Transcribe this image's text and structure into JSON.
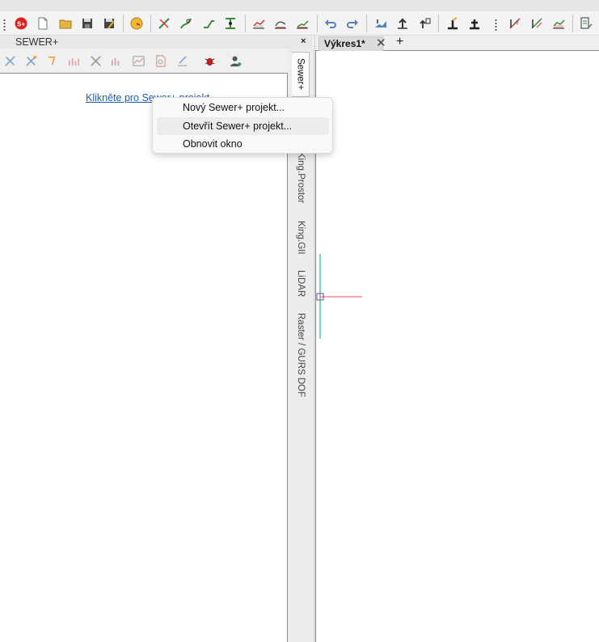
{
  "toolbar": {
    "icons": [
      "sewer-plus-icon",
      "new-document-icon",
      "open-folder-icon",
      "save-icon",
      "save-as-icon",
      "target-icon",
      "pipe-line-icon",
      "pipe-edit-icon",
      "pipe-route-icon",
      "pipe-network-icon",
      "profile-icon",
      "profile-edit-icon",
      "profile-chart-icon",
      "undo-icon",
      "redo-icon",
      "terrain-icon",
      "export-icon",
      "import-icon",
      "cad-tool-icon",
      "anchor-icon",
      "dim-icon",
      "dim-edit-icon",
      "table-icon",
      "report-icon"
    ]
  },
  "panel": {
    "title": "SEWER+",
    "close_label": "×",
    "link_text": "Klikněte pro Sewer+ projekt"
  },
  "vertical_tabs": [
    "Sewer+",
    "King.Prostor",
    "King.GII",
    "LiDAR",
    "Raster / GURS DOF"
  ],
  "document": {
    "tab_label": "Výkres1*",
    "tab_close": "✕",
    "new_tab": "+"
  },
  "context_menu": {
    "items": [
      "Nový Sewer+ projekt...",
      "Otevřít Sewer+ projekt...",
      "Obnovit okno"
    ],
    "hovered_index": 1
  },
  "colors": {
    "link": "#1a5fb4",
    "ucs_y_axis": "#22c27a",
    "ucs_x_axis": "#e0506a",
    "ucs_origin": "#7a3fa6"
  }
}
